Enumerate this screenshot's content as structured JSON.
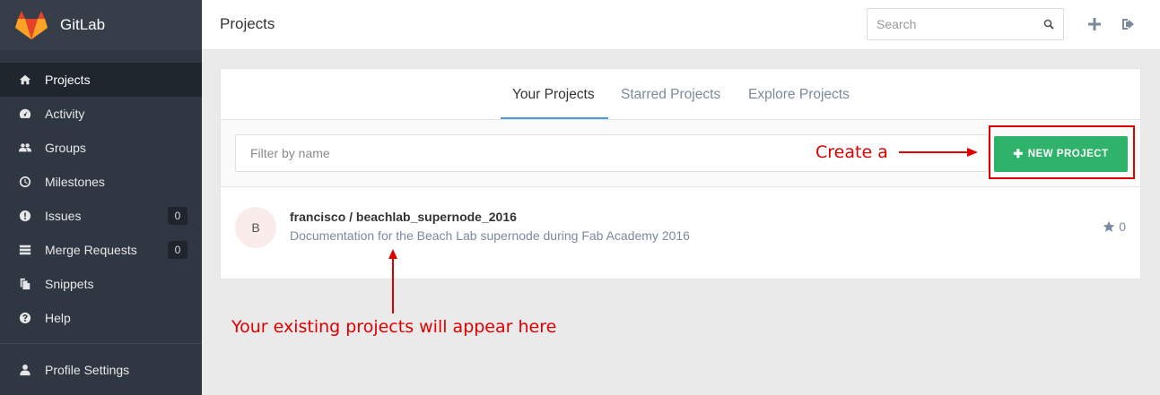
{
  "app": {
    "brand": "GitLab"
  },
  "sidebar": {
    "items": [
      {
        "label": "Projects",
        "icon": "home-icon",
        "active": true
      },
      {
        "label": "Activity",
        "icon": "dashboard-icon"
      },
      {
        "label": "Groups",
        "icon": "users-icon"
      },
      {
        "label": "Milestones",
        "icon": "clock-icon"
      },
      {
        "label": "Issues",
        "icon": "exclamation-icon",
        "badge": "0"
      },
      {
        "label": "Merge Requests",
        "icon": "list-icon",
        "badge": "0"
      },
      {
        "label": "Snippets",
        "icon": "copy-icon"
      },
      {
        "label": "Help",
        "icon": "question-icon"
      }
    ],
    "bottom": {
      "label": "Profile Settings",
      "icon": "user-icon"
    }
  },
  "header": {
    "title": "Projects",
    "search_placeholder": "Search"
  },
  "tabs": [
    {
      "label": "Your Projects",
      "active": true
    },
    {
      "label": "Starred Projects"
    },
    {
      "label": "Explore Projects"
    }
  ],
  "filter": {
    "placeholder": "Filter by name"
  },
  "new_project": {
    "label": "NEW PROJECT"
  },
  "projects": [
    {
      "avatar_letter": "B",
      "name": "francisco / beachlab_supernode_2016",
      "description": "Documentation for the Beach Lab supernode during Fab Academy 2016",
      "stars": "0"
    }
  ],
  "annotations": {
    "create": "Create a",
    "existing": "Your existing projects will appear here"
  },
  "colors": {
    "sidebar": "#2f3742",
    "accent_green": "#2fb36a",
    "annotation_red": "#e00000",
    "tab_active": "#4a9ad4"
  }
}
